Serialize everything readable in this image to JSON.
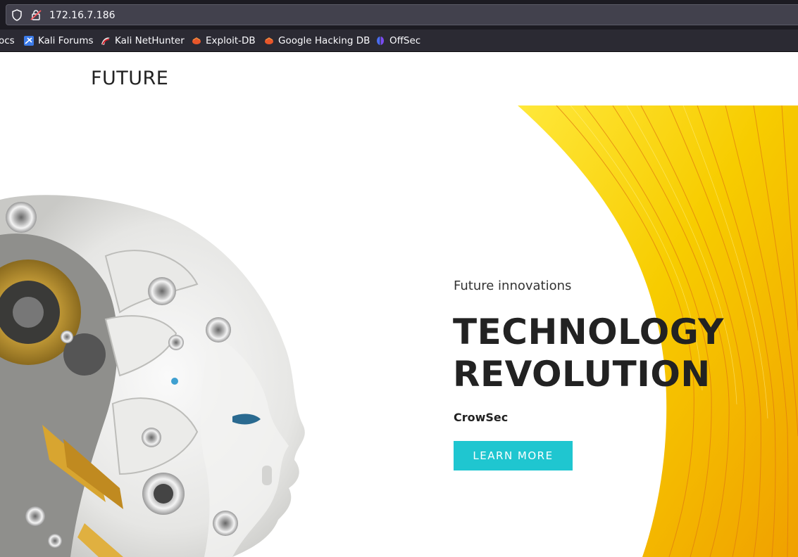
{
  "browser": {
    "url": "172.16.7.186",
    "bookmarks": [
      {
        "label": "ocs",
        "icon": "docs-icon"
      },
      {
        "label": "Kali Forums",
        "icon": "kali-forums-icon"
      },
      {
        "label": "Kali NetHunter",
        "icon": "kali-nethunter-icon"
      },
      {
        "label": "Exploit-DB",
        "icon": "exploit-db-icon"
      },
      {
        "label": "Google Hacking DB",
        "icon": "exploit-db-icon"
      },
      {
        "label": "OffSec",
        "icon": "offsec-icon"
      }
    ]
  },
  "site": {
    "logo": "FUTURE",
    "hero": {
      "eyebrow": "Future innovations",
      "headline_line1": "TECHNOLOGY",
      "headline_line2": "REVOLUTION",
      "brand": "CrowSec",
      "cta_label": "LEARN MORE"
    }
  },
  "colors": {
    "accent": "#1fc6d0",
    "hero_yellow": "#f7cc00",
    "hero_orange": "#f0a000"
  }
}
